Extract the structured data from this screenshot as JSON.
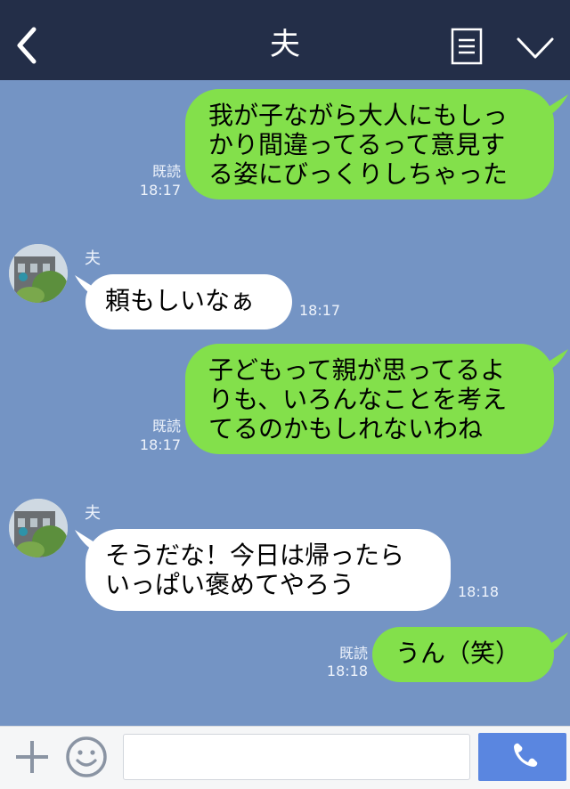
{
  "header": {
    "title": "夫"
  },
  "messages": [
    {
      "from": "me",
      "text": "我が子ながら大人にもしっ\nかり間違ってるって意見す\nる姿にびっくりしちゃった",
      "read": "既読",
      "time": "18:17"
    },
    {
      "from": "夫",
      "text": "頼もしいなぁ",
      "time": "18:17"
    },
    {
      "from": "me",
      "text": "子どもって親が思ってるよ\nりも、いろんなことを考え\nてるのかもしれないわね",
      "read": "既読",
      "time": "18:17"
    },
    {
      "from": "夫",
      "text": "そうだな！今日は帰ったら\nいっぱい褒めてやろう",
      "time": "18:18"
    },
    {
      "from": "me",
      "text": "うん（笑）",
      "read": "既読",
      "time": "18:18"
    }
  ],
  "footer": {
    "input_placeholder": ""
  },
  "colors": {
    "background": "#7494c4",
    "header": "#232e48",
    "outgoing": "#83e04b",
    "incoming": "#ffffff",
    "send": "#5a86e0"
  },
  "icons": [
    "back-icon",
    "menu-icon",
    "chevron-down-icon",
    "plus-icon",
    "emoji-icon",
    "phone-icon"
  ]
}
